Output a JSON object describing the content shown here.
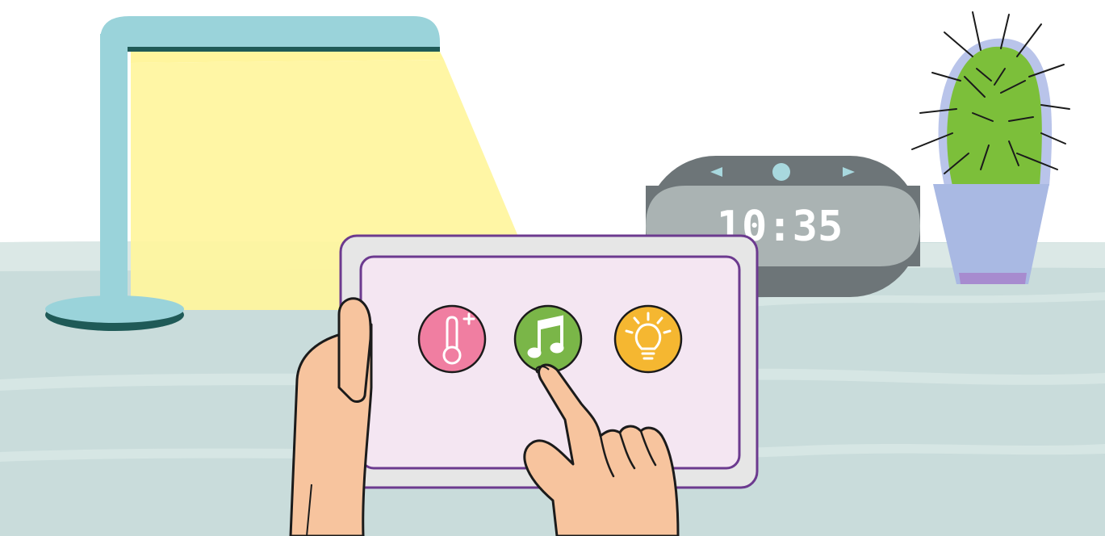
{
  "scene": {
    "colors": {
      "table": "#c9dcdb",
      "table_stripe": "#dbe8e6",
      "lamp": "#9ad3da",
      "lamp_dark": "#1f5a57",
      "light_beam": "#fff59d",
      "tablet_frame": "#e6e6e6",
      "tablet_border": "#6c3a8f",
      "tablet_screen": "#f4e6f2",
      "skin": "#f7c49e",
      "outline": "#1b1b1b",
      "clock_body": "#6d7578",
      "clock_panel": "#aab3b3",
      "clock_dot": "#a8d8de",
      "cactus": "#7cbf3a",
      "cactus_halo": "#b9c4ea",
      "pot": "#a9b9e3",
      "pot_rim": "#a78bcf"
    }
  },
  "clock": {
    "time": "10:35",
    "prev_icon": "triangle-left",
    "next_icon": "triangle-right",
    "indicator_icon": "dot"
  },
  "tablet": {
    "buttons": [
      {
        "icon": "thermometer-plus-icon",
        "color": "#f07ea1"
      },
      {
        "icon": "music-note-icon",
        "color": "#7ab648"
      },
      {
        "icon": "light-bulb-icon",
        "color": "#f5b731"
      }
    ]
  }
}
